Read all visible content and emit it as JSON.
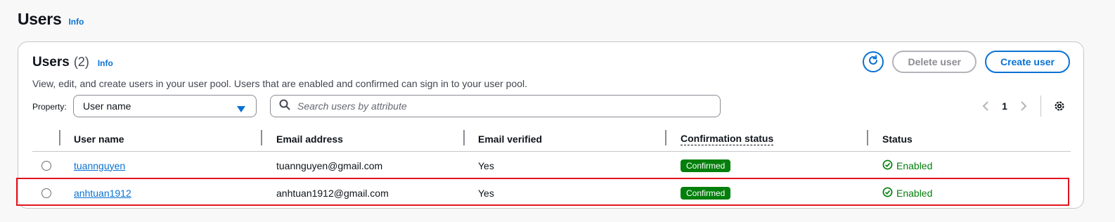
{
  "page": {
    "title": "Users",
    "info": "Info"
  },
  "container": {
    "title": "Users",
    "count": "(2)",
    "info": "Info",
    "description": "View, edit, and create users in your user pool. Users that are enabled and confirmed can sign in to your user pool."
  },
  "actions": {
    "refresh_icon": "refresh-icon",
    "delete_label": "Delete user",
    "create_label": "Create user"
  },
  "filter": {
    "property_label": "Property:",
    "property_value": "User name",
    "search_placeholder": "Search users by attribute"
  },
  "pagination": {
    "current_page": "1"
  },
  "table": {
    "columns": [
      "User name",
      "Email address",
      "Email verified",
      "Confirmation status",
      "Status"
    ],
    "rows": [
      {
        "user_name": "tuannguyen",
        "email": "tuannguyen@gmail.com",
        "email_verified": "Yes",
        "confirmation_status": "Confirmed",
        "status": "Enabled"
      },
      {
        "user_name": "anhtuan1912",
        "email": "anhtuan1912@gmail.com",
        "email_verified": "Yes",
        "confirmation_status": "Confirmed",
        "status": "Enabled"
      }
    ]
  },
  "colors": {
    "accent": "#0972d3",
    "success": "#037f0c",
    "highlight": "#e1141f"
  }
}
